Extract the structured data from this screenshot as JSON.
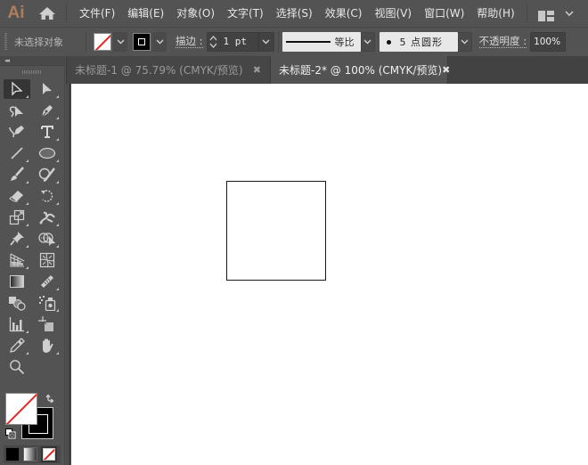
{
  "app": {
    "logo": "Ai",
    "brand_color": "#b07e5c"
  },
  "menubar": {
    "items": [
      {
        "label": "文件(F)"
      },
      {
        "label": "编辑(E)"
      },
      {
        "label": "对象(O)"
      },
      {
        "label": "文字(T)"
      },
      {
        "label": "选择(S)"
      },
      {
        "label": "效果(C)"
      },
      {
        "label": "视图(V)"
      },
      {
        "label": "窗口(W)"
      },
      {
        "label": "帮助(H)"
      }
    ],
    "icons": [
      "home-icon",
      "workspace-layout-icon",
      "chevron-down-icon"
    ]
  },
  "controlbar": {
    "selection_status": "未选择对象",
    "stroke_label": "描边",
    "stroke_colon": ":",
    "stroke_weight": "1 pt",
    "profile_label": "等比",
    "brush_label": "5 点圆形",
    "opacity_label": "不透明度",
    "opacity_colon": ":",
    "opacity_value": "100%",
    "fill_color": "none",
    "stroke_color": "#000000"
  },
  "toolbox": {
    "collapse_label": "◂◂",
    "tools": [
      {
        "name": "selection-tool",
        "active": true
      },
      {
        "name": "direct-selection-tool"
      },
      {
        "name": "magic-wand-tool"
      },
      {
        "name": "pen-tool"
      },
      {
        "name": "curvature-tool"
      },
      {
        "name": "type-tool",
        "glyph": "T"
      },
      {
        "name": "line-segment-tool"
      },
      {
        "name": "ellipse-tool"
      },
      {
        "name": "paintbrush-tool"
      },
      {
        "name": "shaper-tool"
      },
      {
        "name": "eraser-tool"
      },
      {
        "name": "rotate-tool"
      },
      {
        "name": "scale-tool"
      },
      {
        "name": "puppet-warp-tool"
      },
      {
        "name": "pin-tool"
      },
      {
        "name": "shape-builder-tool"
      },
      {
        "name": "perspective-grid-tool"
      },
      {
        "name": "mesh-tool"
      },
      {
        "name": "gradient-tool"
      },
      {
        "name": "measure-tool"
      },
      {
        "name": "blend-tool"
      },
      {
        "name": "symbol-sprayer-tool"
      },
      {
        "name": "column-graph-tool"
      },
      {
        "name": "artboard-tool"
      },
      {
        "name": "slice-tool"
      },
      {
        "name": "hand-tool"
      },
      {
        "name": "zoom-tool"
      }
    ],
    "fill": "none",
    "stroke": "#000000",
    "none_color": "#e52421"
  },
  "tabs": [
    {
      "label": "未标题-1 @ 75.79% (CMYK/预览)",
      "active": false,
      "close": "✖"
    },
    {
      "label": "未标题-2* @ 100% (CMYK/预览)",
      "active": true,
      "close": "✖"
    }
  ],
  "canvas": {
    "artboard_color": "#ffffff",
    "objects": [
      {
        "type": "rectangle",
        "fill": "#ffffff",
        "stroke": "#1a1a1a"
      }
    ]
  }
}
